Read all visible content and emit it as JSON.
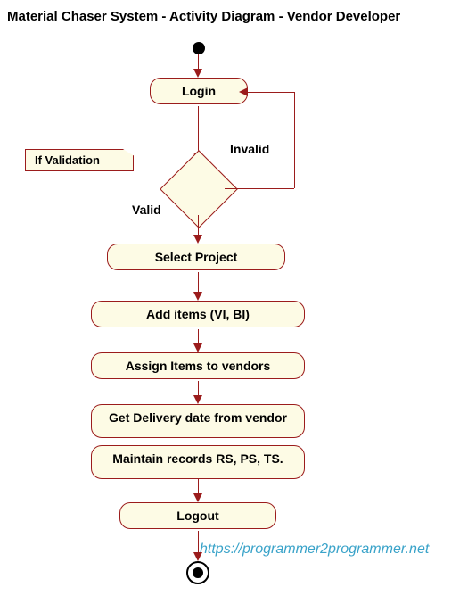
{
  "title": "Material Chaser System - Activity Diagram - Vendor Developer",
  "note": "If Validation",
  "labels": {
    "valid": "Valid",
    "invalid": "Invalid"
  },
  "activities": {
    "login": "Login",
    "select_project": "Select Project",
    "add_items": "Add items (VI,  BI)",
    "assign_items": "Assign Items to vendors",
    "get_delivery": "Get Delivery date from vendor",
    "maintain_records": "Maintain records RS, PS, TS.",
    "logout": "Logout"
  },
  "watermark": "https://programmer2programmer.net"
}
